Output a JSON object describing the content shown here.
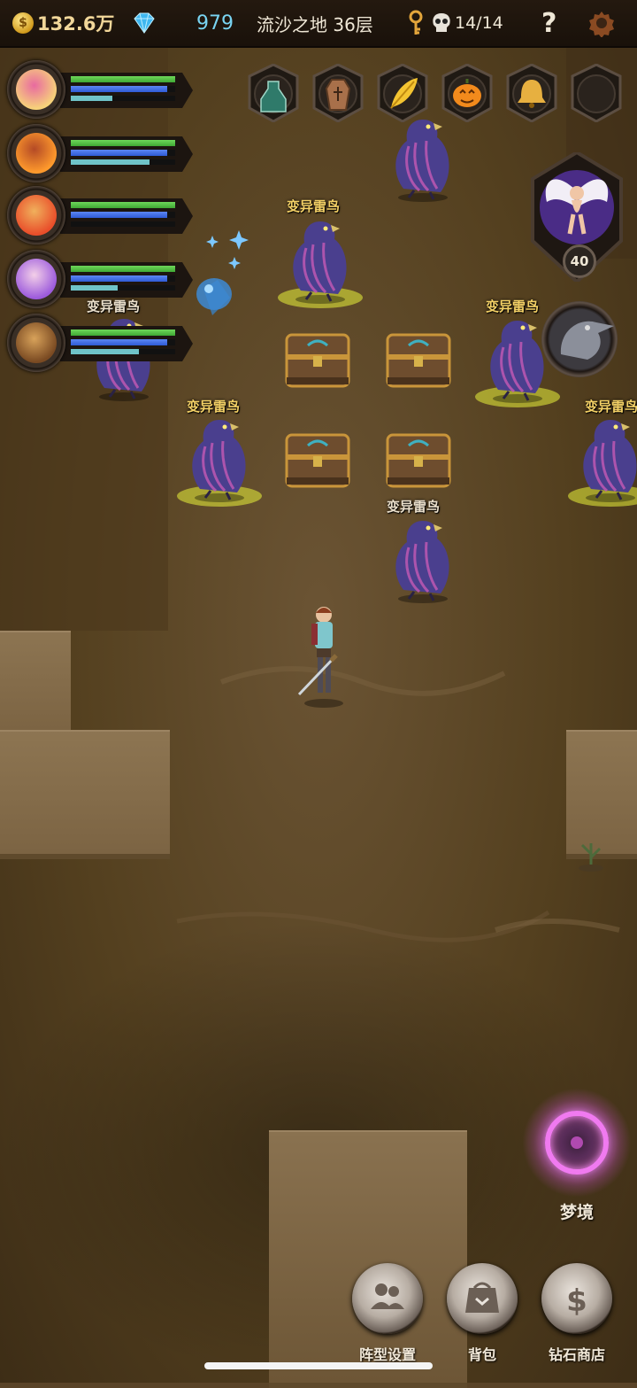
{
  "topbar": {
    "gold_amount": "132.6万",
    "gold_icon_glyph": "$",
    "diamonds": "979",
    "location": "流沙之地 36层",
    "keys_skulls": "14/14",
    "help_glyph": "?"
  },
  "heroes": [
    {
      "name": "hero-1",
      "hp": 1.0,
      "mp": 0.92,
      "xp": 0.4
    },
    {
      "name": "hero-2",
      "hp": 1.0,
      "mp": 0.92,
      "xp": 0.75
    },
    {
      "name": "hero-3",
      "hp": 1.0,
      "mp": 0.92,
      "xp": 0.0
    },
    {
      "name": "hero-4",
      "hp": 1.0,
      "mp": 0.92,
      "xp": 0.45
    },
    {
      "name": "hero-5",
      "hp": 1.0,
      "mp": 0.92,
      "xp": 0.65
    }
  ],
  "item_slots": [
    "potion-icon",
    "coffin-icon",
    "feather-icon",
    "pumpkin-icon",
    "bell-icon",
    "empty-slot"
  ],
  "companion": {
    "level": "40"
  },
  "enemies": {
    "name": "变异雷鸟"
  },
  "dream": {
    "label": "梦境"
  },
  "bottom_buttons": [
    {
      "label": "阵型设置",
      "icon": "team-icon"
    },
    {
      "label": "背包",
      "icon": "bag-icon"
    },
    {
      "label": "钻石商店",
      "icon": "dollar-icon"
    }
  ],
  "colors": {
    "hp": "#3fa834",
    "mp": "#2f5bd6",
    "xp": "#6fc3c8",
    "enemy_label": "#f4d166",
    "glow": "#e9f23a"
  }
}
